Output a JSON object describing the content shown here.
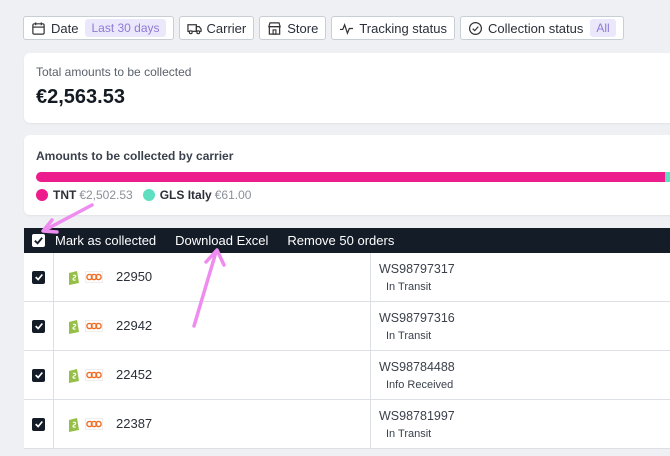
{
  "filters": [
    {
      "label": "Date",
      "icon": "calendar-icon",
      "badge": "Last 30 days"
    },
    {
      "label": "Carrier",
      "icon": "truck-icon"
    },
    {
      "label": "Store",
      "icon": "store-icon"
    },
    {
      "label": "Tracking status",
      "icon": "pulse-icon"
    },
    {
      "label": "Collection status",
      "icon": "check-circle-icon",
      "badge": "All"
    }
  ],
  "total_card": {
    "label": "Total amounts to be collected",
    "value": "€2,563.53"
  },
  "carrier_card": {
    "label": "Amounts to be collected by carrier",
    "carriers": [
      {
        "name": "TNT",
        "amount": "€2,502.53",
        "value": 2502.53,
        "color": "#ec1c8c"
      },
      {
        "name": "GLS Italy",
        "amount": "€61.00",
        "value": 61.0,
        "color": "#5ee0c0"
      }
    ]
  },
  "actions": {
    "mark": "Mark as collected",
    "download": "Download Excel",
    "remove": "Remove 50 orders"
  },
  "orders": [
    {
      "number": "22950",
      "tracking": "WS98797317",
      "status": "In Transit"
    },
    {
      "number": "22942",
      "tracking": "WS98797316",
      "status": "In Transit"
    },
    {
      "number": "22452",
      "tracking": "WS98784488",
      "status": "Info Received"
    },
    {
      "number": "22387",
      "tracking": "WS98781997",
      "status": "In Transit"
    }
  ],
  "colors": {
    "accent": "#ec1c8c",
    "secondary": "#5ee0c0",
    "dark": "#141c28",
    "badge_text": "#8f7ad6",
    "annotation_arrow": "#ee8cf0"
  }
}
